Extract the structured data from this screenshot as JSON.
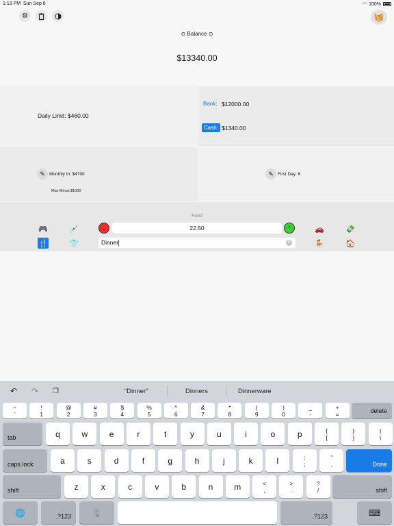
{
  "status": {
    "time": "1:13 PM",
    "date": "Sun Sep 8",
    "battery": "100%"
  },
  "toolbar": {
    "settings_icon": "gear-icon",
    "trash_icon": "trash-icon",
    "theme_icon": "contrast-icon",
    "basket_icon": "basket-icon"
  },
  "balance": {
    "title": "Balance",
    "value": "$13340.00"
  },
  "limits": {
    "daily_limit": "Daily Limit: $460.00",
    "bank_label": "Bank:",
    "bank_value": "$12000.00",
    "cash_label": "Cash:",
    "cash_value": "$1340.00"
  },
  "monthly": {
    "monthly_in": "Monthly In: $4700",
    "max_minus": "Max Minus:$1000",
    "first_day": "First Day: 6"
  },
  "entry": {
    "category": "Food",
    "amount": "22.50",
    "note": "Dinner"
  },
  "suggestions": [
    "“Dinner”",
    "Dinners",
    "Dinnerware"
  ],
  "keyboard": {
    "row1": [
      [
        "~",
        "`"
      ],
      [
        "!",
        "1"
      ],
      [
        "@",
        "2"
      ],
      [
        "#",
        "3"
      ],
      [
        "$",
        "4"
      ],
      [
        "%",
        "5"
      ],
      [
        "^",
        "6"
      ],
      [
        "&",
        "7"
      ],
      [
        "*",
        "8"
      ],
      [
        "(",
        "9"
      ],
      [
        ")",
        "0"
      ],
      [
        "_",
        "-"
      ],
      [
        "+",
        "="
      ]
    ],
    "delete": "delete",
    "tab": "tab",
    "row2": [
      "q",
      "w",
      "e",
      "r",
      "t",
      "y",
      "u",
      "i",
      "o",
      "p"
    ],
    "row2_extra": [
      [
        "{",
        "["
      ],
      [
        "}",
        "]"
      ],
      [
        "|",
        "\\"
      ]
    ],
    "caps": "caps lock",
    "row3": [
      "a",
      "s",
      "d",
      "f",
      "g",
      "h",
      "j",
      "k",
      "l"
    ],
    "row3_extra": [
      [
        ":",
        ";"
      ],
      [
        "”",
        ","
      ]
    ],
    "done": "Done",
    "shift": "shift",
    "row4": [
      "z",
      "x",
      "c",
      "v",
      "b",
      "n",
      "m"
    ],
    "row4_extra": [
      [
        "<",
        ","
      ],
      [
        ">",
        "."
      ],
      [
        "?",
        "/"
      ]
    ],
    "numkey": ".?123"
  }
}
